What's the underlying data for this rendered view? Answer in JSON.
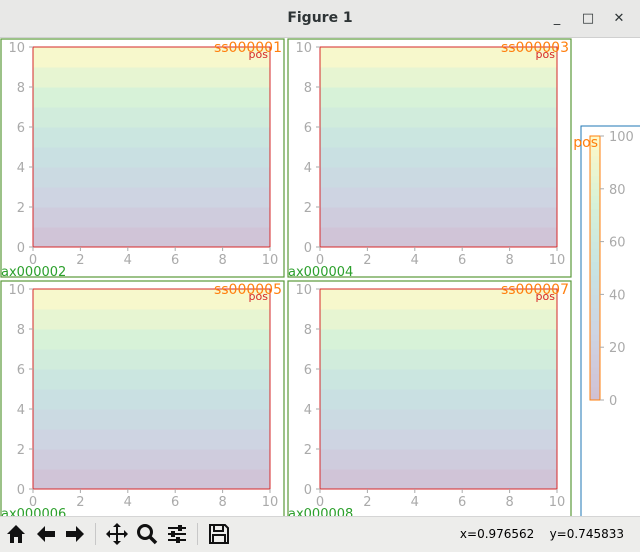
{
  "window": {
    "title": "Figure 1"
  },
  "window_buttons": {
    "minimize": "_",
    "maximize": "□",
    "close": "✕"
  },
  "toolbar": {
    "items": [
      "home-icon",
      "back-icon",
      "forward-icon",
      "pan-icon",
      "zoom-icon",
      "configure-subplots-icon",
      "save-icon"
    ]
  },
  "status": {
    "coords": "x=0.976562    y=0.745833"
  },
  "colors": {
    "outer_border": "#5a9a3a",
    "inner_border": "#d62728",
    "label_orange": "#ff7f0e",
    "label_green": "#2ca02c",
    "label_red": "#d62728",
    "cbar_border": "#1f77b4"
  },
  "chart_data": [
    {
      "type": "heatmap",
      "title": "ss000001",
      "subplot_label": "ax000002",
      "image_label": "pos",
      "xlim": [
        0,
        10
      ],
      "ylim": [
        0,
        10
      ],
      "xticks": [
        "0",
        "2",
        "4",
        "6",
        "8",
        "10"
      ],
      "yticks": [
        "0",
        "2",
        "4",
        "6",
        "8",
        "10"
      ],
      "cmap": "viridis",
      "alpha": 0.25,
      "value_range": [
        0,
        100
      ]
    },
    {
      "type": "heatmap",
      "title": "ss000003",
      "subplot_label": "ax000004",
      "image_label": "pos",
      "xlim": [
        0,
        10
      ],
      "ylim": [
        0,
        10
      ],
      "xticks": [
        "0",
        "2",
        "4",
        "6",
        "8",
        "10"
      ],
      "yticks": [
        "0",
        "2",
        "4",
        "6",
        "8",
        "10"
      ],
      "cmap": "viridis",
      "alpha": 0.25,
      "value_range": [
        0,
        100
      ]
    },
    {
      "type": "heatmap",
      "title": "ss000005",
      "subplot_label": "ax000006",
      "image_label": "pos",
      "xlim": [
        0,
        10
      ],
      "ylim": [
        0,
        10
      ],
      "xticks": [
        "0",
        "2",
        "4",
        "6",
        "8",
        "10"
      ],
      "yticks": [
        "0",
        "2",
        "4",
        "6",
        "8",
        "10"
      ],
      "cmap": "viridis",
      "alpha": 0.25,
      "value_range": [
        0,
        100
      ]
    },
    {
      "type": "heatmap",
      "title": "ss000007",
      "subplot_label": "ax000008",
      "image_label": "pos",
      "xlim": [
        0,
        10
      ],
      "ylim": [
        0,
        10
      ],
      "xticks": [
        "0",
        "2",
        "4",
        "6",
        "8",
        "10"
      ],
      "yticks": [
        "0",
        "2",
        "4",
        "6",
        "8",
        "10"
      ],
      "cmap": "viridis",
      "alpha": 0.25,
      "value_range": [
        0,
        100
      ]
    }
  ],
  "colorbar": {
    "label": "pos",
    "ticks": [
      "0",
      "20",
      "40",
      "60",
      "80",
      "100"
    ],
    "range": [
      0,
      100
    ]
  }
}
